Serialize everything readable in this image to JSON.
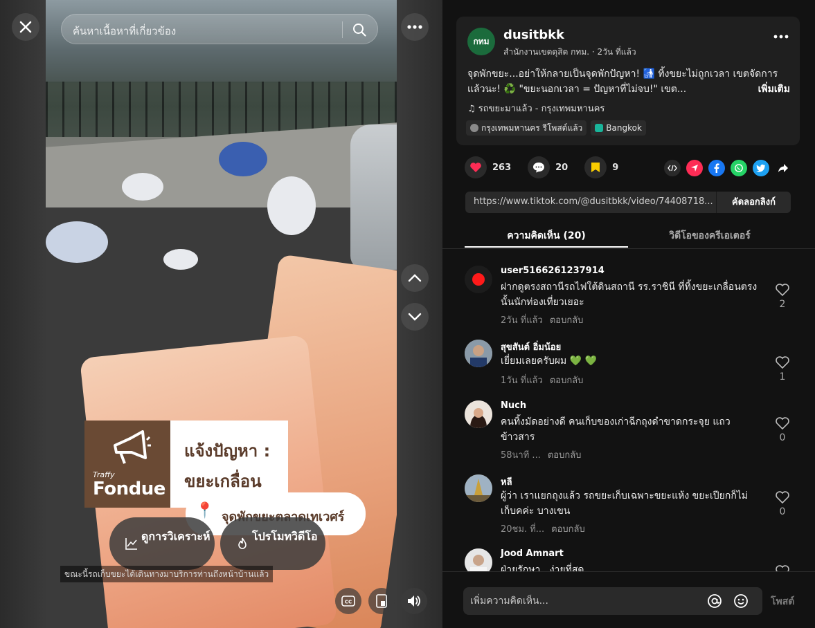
{
  "video": {
    "search_placeholder": "ค้นหาเนื้อหาที่เกี่ยวข้อง",
    "overlay_title_line1": "แจ้งปัญหา :",
    "overlay_title_line2": "ขยะเกลื่อน",
    "overlay_location": "จุดพักขยะตลาดเทเวศร์",
    "logo_small": "Traffy",
    "logo_big": "Fondue",
    "analytics_label": "ดูการวิเคราะห์",
    "promote_label": "โปรโมทวิดีโอ",
    "caption": "ขณะนี้รถเก็บขยะได้เดินทางมาบริการท่านถึงหน้าบ้านแล้ว"
  },
  "post": {
    "author_avatar_text": "กทม",
    "author_name": "dusitbkk",
    "author_sub": "สำนักงานเขตดุสิต กทม. · 2วัน ที่แล้ว",
    "text": "จุดพักขยะ...อย่าให้กลายเป็นจุดพักปัญหา! 🚮 ทิ้งขยะไม่ถูกเวลา เขตจัดการแล้วนะ! ♻️ \"ขยะนอกเวลา = ปัญหาที่ไม่จบ!\" เขต...",
    "more_label": "เพิ่มเติม",
    "music": "♫  รถขยะมาแล้ว - กรุงเทพมหานคร",
    "tags": [
      {
        "label": "กรุงเทพมหานคร รีโพสต์แล้ว",
        "color": "#8a8a8a"
      },
      {
        "label": "Bangkok",
        "color": "#19b49a"
      }
    ]
  },
  "stats": {
    "likes": "263",
    "comments": "20",
    "saves": "9"
  },
  "link": {
    "url": "https://www.tiktok.com/@dusitbkk/video/74408718...",
    "copy_label": "คัดลอกลิงก์"
  },
  "tabs": {
    "comments": "ความคิดเห็น (20)",
    "creator_videos": "วิดีโอของครีเอเตอร์"
  },
  "comments": [
    {
      "user": "user5166261237914",
      "text": "ฝากดูตรงสถานีรถไฟใต้ดินสถานี รร.ราชินี ที่ทิ้งขยะเกลื่อนตรงนั้นนักท่องเที่ยวเยอะ",
      "time": "2วัน ที่แล้ว",
      "reply": "ตอบกลับ",
      "likes": "2"
    },
    {
      "user": "สุขสันต์ อิ่มน้อย",
      "text": "เยี่ยมเลยครับผม 💚 💚",
      "time": "1วัน ที่แล้ว",
      "reply": "ตอบกลับ",
      "likes": "1"
    },
    {
      "user": "Nuch",
      "text": "คนทิ้งมัดอย่างดี คนเก็บของเก่าฉีกถุงดำขาดกระจุย แถวข้าวสาร",
      "time": "58นาที ...",
      "reply": "ตอบกลับ",
      "likes": "0"
    },
    {
      "user": "หลี",
      "text": "ผู้ว่า เราแยกถุงแล้ว รถขยะเก็บเฉพาะขยะแห้ง ขยะเปียกก็ไม่เก็บคค่ะ บางเขน",
      "time": "20ชม. ที่...",
      "reply": "ตอบกลับ",
      "likes": "0"
    },
    {
      "user": "Jood Amnart",
      "text": "ฝ่ายรักษา...ง่ายที่สุด",
      "time": "",
      "reply": "",
      "likes": ""
    }
  ],
  "composer": {
    "placeholder": "เพิ่มความคิดเห็น...",
    "post_label": "โพสต์"
  },
  "colors": {
    "like": "#fe2c55",
    "save": "#facd00",
    "share_send": "#fe2c55",
    "facebook": "#1877f2",
    "whatsapp": "#25d366",
    "twitter": "#1da1f2"
  }
}
